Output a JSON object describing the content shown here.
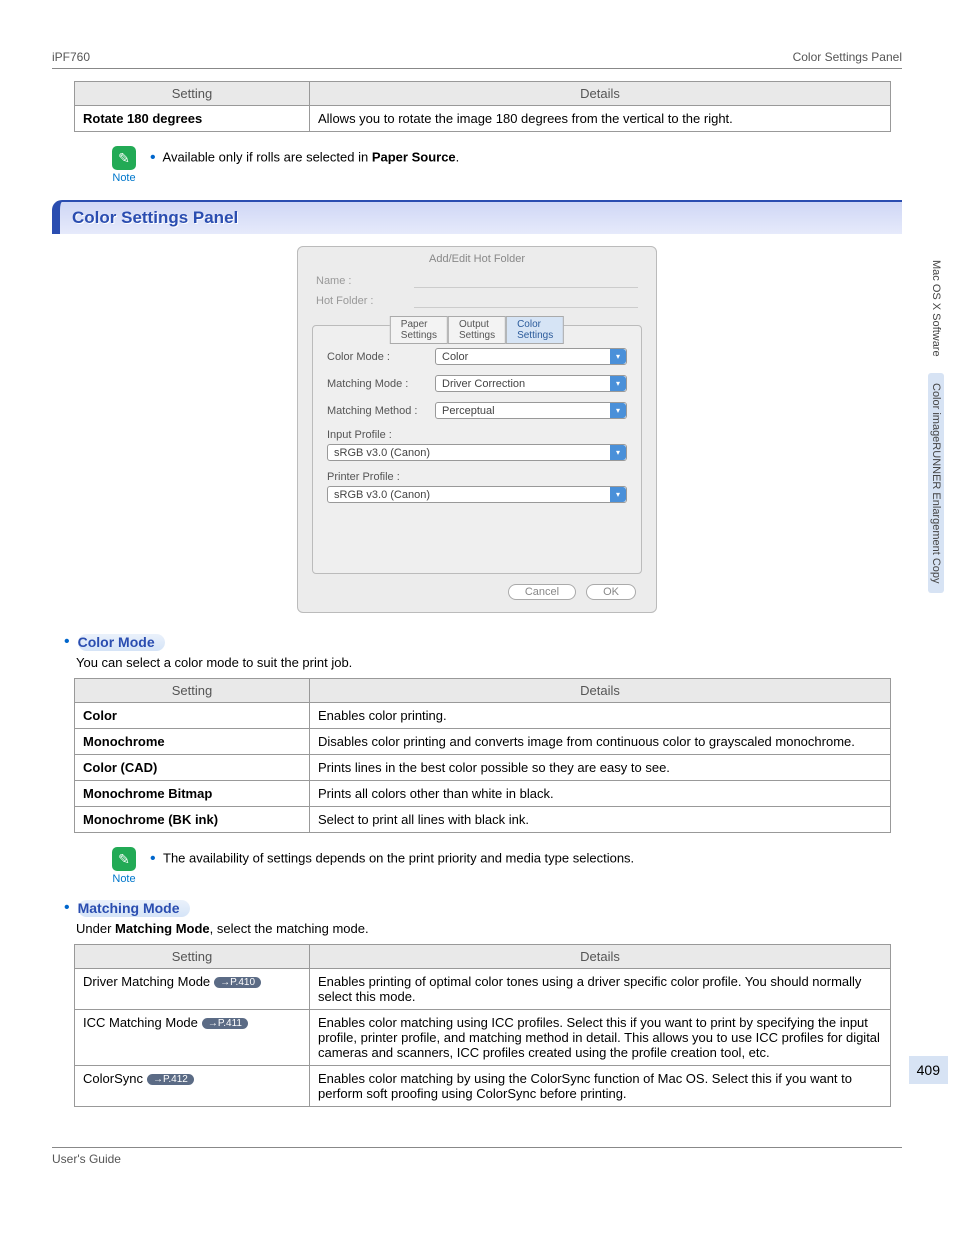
{
  "header": {
    "left": "iPF760",
    "right": "Color Settings Panel"
  },
  "table1": {
    "headers": [
      "Setting",
      "Details"
    ],
    "rows": [
      {
        "setting": "Rotate 180 degrees",
        "details": "Allows you to rotate the image 180 degrees from the vertical to the right."
      }
    ]
  },
  "note1": {
    "label": "Note",
    "text": "Available only if rolls are selected in ",
    "bold": "Paper Source",
    "suffix": "."
  },
  "banner": "Color Settings Panel",
  "dialog": {
    "title": "Add/Edit Hot Folder",
    "name_label": "Name :",
    "folder_label": "Hot Folder :",
    "tabs": [
      "Paper Settings",
      "Output Settings",
      "Color Settings"
    ],
    "color_mode_label": "Color Mode :",
    "color_mode_value": "Color",
    "matching_mode_label": "Matching Mode :",
    "matching_mode_value": "Driver Correction",
    "matching_method_label": "Matching Method :",
    "matching_method_value": "Perceptual",
    "input_profile_label": "Input Profile :",
    "input_profile_value": "sRGB v3.0 (Canon)",
    "printer_profile_label": "Printer Profile :",
    "printer_profile_value": "sRGB v3.0 (Canon)",
    "cancel": "Cancel",
    "ok": "OK"
  },
  "color_mode": {
    "title": "Color Mode",
    "desc": "You can select a color mode to suit the print job.",
    "headers": [
      "Setting",
      "Details"
    ],
    "rows": [
      {
        "setting": "Color",
        "details": "Enables color printing."
      },
      {
        "setting": "Monochrome",
        "details": "Disables color printing and converts image from continuous color to grayscaled monochrome."
      },
      {
        "setting": "Color (CAD)",
        "details": "Prints lines in the best color possible so they are easy to see."
      },
      {
        "setting": "Monochrome Bitmap",
        "details": "Prints all colors other than white in black."
      },
      {
        "setting": "Monochrome (BK ink)",
        "details": "Select to print all lines with black ink."
      }
    ]
  },
  "note2": {
    "label": "Note",
    "text": "The availability of settings depends on the print priority and media type selections."
  },
  "matching_mode": {
    "title": "Matching Mode",
    "desc_pre": "Under ",
    "desc_bold": "Matching Mode",
    "desc_post": ", select the matching mode.",
    "headers": [
      "Setting",
      "Details"
    ],
    "rows": [
      {
        "setting": "Driver Matching Mode",
        "pill": "→P.410",
        "details": "Enables printing of optimal color tones using a driver specific color profile. You should normally select this mode."
      },
      {
        "setting": "ICC Matching Mode",
        "pill": "→P.411",
        "details": "Enables color matching using ICC profiles. Select this if you want to print by specifying the input profile, printer profile, and matching method in detail. This allows you to use ICC profiles for digital cameras and scanners, ICC profiles created using the profile creation tool, etc."
      },
      {
        "setting": "ColorSync",
        "pill": "→P.412",
        "details": "Enables color matching by using the ColorSync function of Mac OS. Select this if you want to perform soft proofing using ColorSync before printing."
      }
    ]
  },
  "side": {
    "tab1": "Mac OS X Software",
    "tab2": "Color imageRUNNER Enlargement Copy"
  },
  "page_number": "409",
  "footer": "User's Guide"
}
